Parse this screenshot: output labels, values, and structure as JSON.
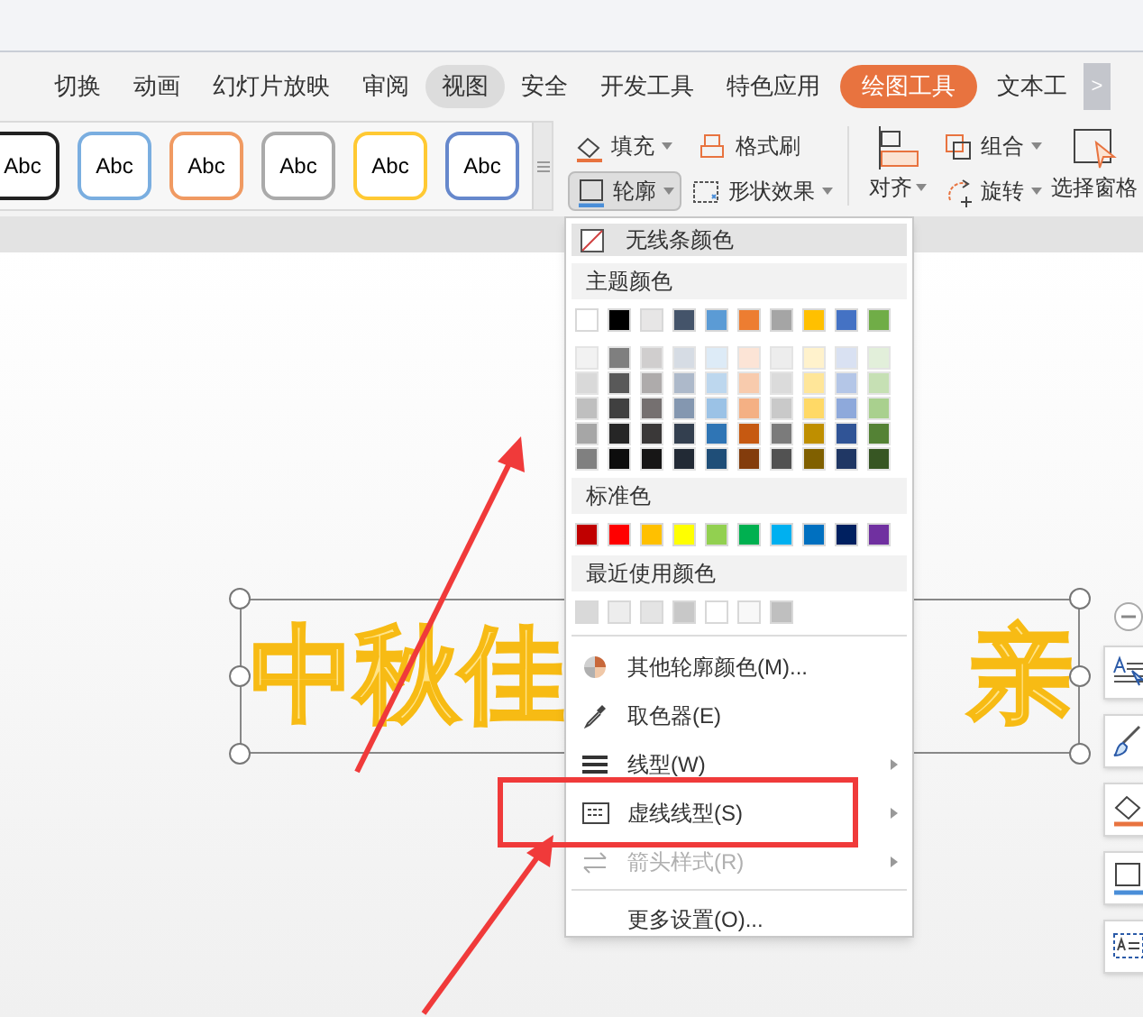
{
  "tabs": [
    {
      "label": "切换",
      "selected": false,
      "hovered": false
    },
    {
      "label": "动画",
      "selected": false,
      "hovered": false
    },
    {
      "label": "幻灯片放映",
      "selected": false,
      "hovered": false
    },
    {
      "label": "审阅",
      "selected": false,
      "hovered": false
    },
    {
      "label": "视图",
      "selected": false,
      "hovered": true
    },
    {
      "label": "安全",
      "selected": false,
      "hovered": false
    },
    {
      "label": "开发工具",
      "selected": false,
      "hovered": false
    },
    {
      "label": "特色应用",
      "selected": false,
      "hovered": false
    },
    {
      "label": "绘图工具",
      "selected": true,
      "hovered": false
    },
    {
      "label": "文本工",
      "selected": false,
      "hovered": false
    }
  ],
  "tab_scroll": ">",
  "style_gallery": [
    {
      "label": "Abc",
      "color": "#222222"
    },
    {
      "label": "Abc",
      "color": "#7aaee0"
    },
    {
      "label": "Abc",
      "color": "#f09a62"
    },
    {
      "label": "Abc",
      "color": "#aaaaaa"
    },
    {
      "label": "Abc",
      "color": "#ffc933"
    },
    {
      "label": "Abc",
      "color": "#6688cc"
    }
  ],
  "format_buttons": [
    {
      "label": "填充",
      "dropdown": true,
      "hovered": false
    },
    {
      "label": "格式刷",
      "dropdown": false,
      "hovered": false
    },
    {
      "label": "轮廓",
      "dropdown": true,
      "hovered": true
    },
    {
      "label": "形状效果",
      "dropdown": true,
      "hovered": false
    }
  ],
  "align_button": {
    "label": "对齐",
    "dropdown": true
  },
  "arrange_buttons": [
    {
      "label": "组合",
      "dropdown": true
    },
    {
      "label": "旋转",
      "dropdown": true
    }
  ],
  "selection_pane_button": {
    "label": "选择窗格",
    "dropdown": false
  },
  "slide": {
    "text_parts": [
      "中秋佳",
      "亲"
    ],
    "selected": true
  },
  "menu": {
    "no_color": {
      "label": "无线条颜色",
      "highlighted": true
    },
    "theme_header": "主题颜色",
    "theme_colors": [
      {
        "color": "#ffffff"
      },
      {
        "color": "#000000"
      },
      {
        "color": "#e7e6e6"
      },
      {
        "color": "#44546a"
      },
      {
        "color": "#5b9bd5"
      },
      {
        "color": "#ed7d31"
      },
      {
        "color": "#a5a5a5"
      },
      {
        "color": "#ffc000"
      },
      {
        "color": "#4472c4"
      },
      {
        "color": "#70ad47"
      }
    ],
    "shade_rows": [
      {
        "swatches": [
          {
            "color": "#f2f2f2"
          },
          {
            "color": "#7f7f7f"
          },
          {
            "color": "#d0cece"
          },
          {
            "color": "#d6dce4"
          },
          {
            "color": "#ddebf7"
          },
          {
            "color": "#fce4d6"
          },
          {
            "color": "#ededed"
          },
          {
            "color": "#fff2cc"
          },
          {
            "color": "#d9e1f2"
          },
          {
            "color": "#e2efda"
          }
        ]
      },
      {
        "swatches": [
          {
            "color": "#d9d9d9"
          },
          {
            "color": "#595959"
          },
          {
            "color": "#aeabab"
          },
          {
            "color": "#adb9ca"
          },
          {
            "color": "#bdd7ee"
          },
          {
            "color": "#f8cbad"
          },
          {
            "color": "#dbdbdb"
          },
          {
            "color": "#ffe699"
          },
          {
            "color": "#b4c6e7"
          },
          {
            "color": "#c6e0b4"
          }
        ]
      },
      {
        "swatches": [
          {
            "color": "#bfbfbf"
          },
          {
            "color": "#404040"
          },
          {
            "color": "#757070"
          },
          {
            "color": "#8497b0"
          },
          {
            "color": "#9bc2e6"
          },
          {
            "color": "#f4b084"
          },
          {
            "color": "#c9c9c9"
          },
          {
            "color": "#ffd966"
          },
          {
            "color": "#8ea9db"
          },
          {
            "color": "#a9d08e"
          }
        ]
      },
      {
        "swatches": [
          {
            "color": "#a6a6a6"
          },
          {
            "color": "#262626"
          },
          {
            "color": "#3a3838"
          },
          {
            "color": "#333f4f"
          },
          {
            "color": "#2f75b5"
          },
          {
            "color": "#c65911"
          },
          {
            "color": "#7b7b7b"
          },
          {
            "color": "#bf8f00"
          },
          {
            "color": "#305496"
          },
          {
            "color": "#548235"
          }
        ]
      },
      {
        "swatches": [
          {
            "color": "#808080"
          },
          {
            "color": "#0d0d0d"
          },
          {
            "color": "#171616"
          },
          {
            "color": "#222a35"
          },
          {
            "color": "#1f4e78"
          },
          {
            "color": "#833c0c"
          },
          {
            "color": "#525252"
          },
          {
            "color": "#806000"
          },
          {
            "color": "#203764"
          },
          {
            "color": "#375623"
          }
        ]
      }
    ],
    "standard_header": "标准色",
    "standard_colors": [
      {
        "color": "#c00000"
      },
      {
        "color": "#ff0000"
      },
      {
        "color": "#ffc000"
      },
      {
        "color": "#ffff00"
      },
      {
        "color": "#92d050"
      },
      {
        "color": "#00b050"
      },
      {
        "color": "#00b0f0"
      },
      {
        "color": "#0070c0"
      },
      {
        "color": "#002060"
      },
      {
        "color": "#7030a0"
      }
    ],
    "recent_header": "最近使用颜色",
    "recent_colors": [
      {
        "color": "#d9d9d9"
      },
      {
        "color": "#ededed"
      },
      {
        "color": "#e4e4e4"
      },
      {
        "color": "#c8c8c8"
      },
      {
        "color": "#ffffff"
      },
      {
        "color": "#f8f8f8"
      },
      {
        "color": "#bfbfbf"
      }
    ],
    "items": [
      {
        "label": "其他轮廓颜色(M)...",
        "submenu": false,
        "disabled": false
      },
      {
        "label": "取色器(E)",
        "submenu": false,
        "disabled": false
      },
      {
        "label": "线型(W)",
        "submenu": true,
        "disabled": false
      },
      {
        "label": "虚线线型(S)",
        "submenu": true,
        "disabled": false
      },
      {
        "label": "箭头样式(R)",
        "submenu": true,
        "disabled": true
      },
      {
        "label": "更多设置(O)...",
        "submenu": false,
        "disabled": false
      }
    ]
  }
}
